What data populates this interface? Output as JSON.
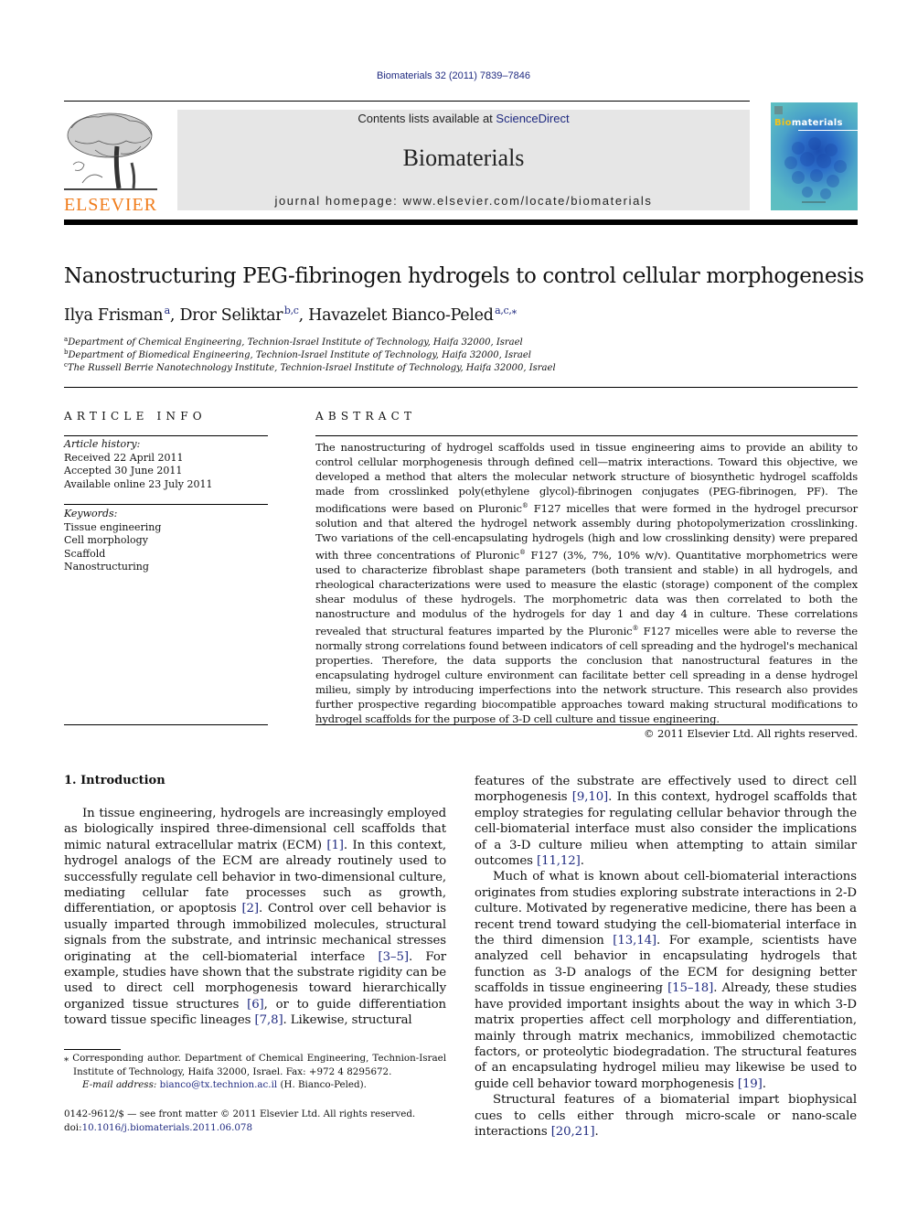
{
  "header": {
    "citation": "Biomaterials 32 (2011) 7839–7846",
    "contents_prefix": "Contents lists available at ",
    "contents_link": "ScienceDirect",
    "journal_title": "Biomaterials",
    "homepage_label": "journal homepage: ",
    "homepage_url": "www.elsevier.com/locate/biomaterials",
    "publisher_logo_text": "ELSEVIER",
    "cover_title_bold": "Bio",
    "cover_title_rest": "materials"
  },
  "article": {
    "title": "Nanostructuring PEG-fibrinogen hydrogels to control cellular morphogenesis",
    "authors": [
      {
        "name": "Ilya Frisman",
        "sup": "a"
      },
      {
        "name": "Dror Seliktar",
        "sup": "b,c"
      },
      {
        "name": "Havazelet Bianco-Peled",
        "sup": "a,c,⁎"
      }
    ],
    "affiliations": [
      {
        "key": "a",
        "text": "Department of Chemical Engineering, Technion-Israel Institute of Technology, Haifa 32000, Israel"
      },
      {
        "key": "b",
        "text": "Department of Biomedical Engineering, Technion-Israel Institute of Technology, Haifa 32000, Israel"
      },
      {
        "key": "c",
        "text": "The Russell Berrie Nanotechnology Institute, Technion-Israel Institute of Technology, Haifa 32000, Israel"
      }
    ]
  },
  "article_info": {
    "heading": "ARTICLE INFO",
    "history_label": "Article history:",
    "received": "Received 22 April 2011",
    "accepted": "Accepted 30 June 2011",
    "online": "Available online 23 July 2011",
    "keywords_label": "Keywords:",
    "keywords": [
      "Tissue engineering",
      "Cell morphology",
      "Scaffold",
      "Nanostructuring"
    ]
  },
  "abstract": {
    "heading": "ABSTRACT",
    "text_1": "The nanostructuring of hydrogel scaffolds used in tissue engineering aims to provide an ability to control cellular morphogenesis through defined cell—matrix interactions. Toward this objective, we developed a method that alters the molecular network structure of biosynthetic hydrogel scaffolds made from crosslinked poly(ethylene glycol)-fibrinogen conjugates (PEG-fibrinogen, PF). The modifications were based on Pluronic",
    "text_2": " F127 micelles that were formed in the hydrogel precursor solution and that altered the hydrogel network assembly during photopolymerization crosslinking. Two variations of the cell-encapsulating hydrogels (high and low crosslinking density) were prepared with three concentrations of Pluronic",
    "text_3": " F127 (3%, 7%, 10% w/v). Quantitative morphometrics were used to characterize fibroblast shape parameters (both transient and stable) in all hydrogels, and rheological characterizations were used to measure the elastic (storage) component of the complex shear modulus of these hydrogels. The morphometric data was then correlated to both the nanostructure and modulus of the hydrogels for day 1 and day 4 in culture. These correlations revealed that structural features imparted by the Pluronic",
    "text_4": " F127 micelles were able to reverse the normally strong correlations found between indicators of cell spreading and the hydrogel's mechanical properties. Therefore, the data supports the conclusion that nanostructural features in the encapsulating hydrogel culture environment can facilitate better cell spreading in a dense hydrogel milieu, simply by introducing imperfections into the network structure. This research also provides further prospective regarding biocompatible approaches toward making structural modifications to hydrogel scaffolds for the purpose of 3-D cell culture and tissue engineering.",
    "registered": "®",
    "copyright": "© 2011 Elsevier Ltd. All rights reserved."
  },
  "intro": {
    "heading": "1.  Introduction",
    "left_p1": [
      "In tissue engineering, hydrogels are increasingly employed as biologically inspired three-dimensional cell scaffolds that mimic natural extracellular matrix (ECM) ",
      "[1]",
      ". In this context, hydrogel analogs of the ECM are already routinely used to successfully regulate cell behavior in two-dimensional culture, mediating cellular fate processes such as growth, differentiation, or apoptosis ",
      "[2]",
      ". Control over cell behavior is usually imparted through immo­bilized molecules, structural signals from the substrate, and intrinsic mechanical stresses originating at the cell-biomaterial interface ",
      "[3–5]",
      ". For example, studies have shown that the substrate rigidity can be used to direct cell morphogenesis toward hierarchically organized tissue structures ",
      "[6]",
      ", or to guide differen­tiation toward tissue specific lineages ",
      "[7,8]",
      ". Likewise, structural"
    ],
    "right_p1": [
      "features of the substrate are effectively used to direct cell morphogenesis ",
      "[9,10]",
      ". In this context, hydrogel scaffolds that employ strategies for regulating cellular behavior through the cell-biomaterial interface must also consider the implications of a 3-D culture milieu when attempting to attain similar outcomes ",
      "[11,12]",
      "."
    ],
    "right_p2": [
      "Much of what is known about cell-biomaterial interactions originates from studies exploring substrate interactions in 2-D culture. Motivated by regenerative medicine, there has been a recent trend toward studying the cell-biomaterial interface in the third dimension ",
      "[13,14]",
      ". For example, scientists have analyzed cell behavior in encapsulating hydrogels that function as 3-D analogs of the ECM for designing better scaffolds in tissue engineering ",
      "[15–18]",
      ". Already, these studies have provided important insights about the way in which 3-D matrix properties affect cell morphology and differentiation, mainly through matrix mechanics, immobilized chemotactic factors, or proteolytic biodegradation. The structural features of an encapsulating hydrogel milieu may likewise be used to guide cell behavior toward morphogenesis ",
      "[19]",
      "."
    ],
    "right_p3": [
      "Structural features of a biomaterial impart biophysical cues to cells either through micro-scale or nano-scale interactions ",
      "[20,21]",
      "."
    ]
  },
  "footnote": {
    "star": "⁎",
    "corresponding": " Corresponding author. Department of Chemical Engineering, Technion-Israel Institute of Technology, Haifa 32000, Israel. Fax: +972 4 8295672.",
    "email_label": "E-mail address: ",
    "email": "bianco@tx.technion.ac.il",
    "email_suffix": " (H. Bianco-Peled).",
    "front_matter": "0142-9612/$ — see front matter © 2011 Elsevier Ltd. All rights reserved.",
    "doi_label": "doi:",
    "doi": "10.1016/j.biomaterials.2011.06.078"
  }
}
